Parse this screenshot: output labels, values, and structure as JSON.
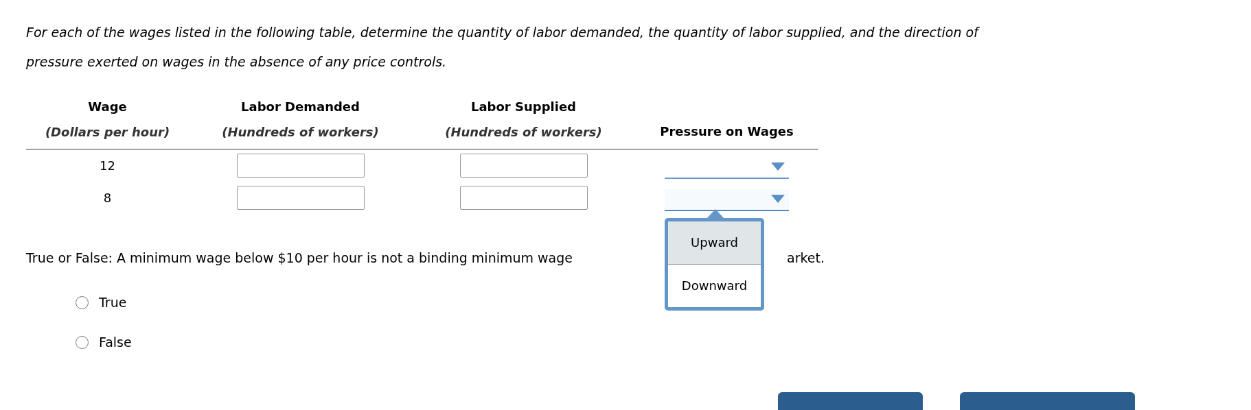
{
  "instructions": "For each of the wages listed in the following table, determine the quantity of labor demanded, the quantity of labor supplied, and the direction of pressure exerted on wages in the absence of any price controls.",
  "table": {
    "columns": [
      {
        "title": "Wage",
        "subtitle": "(Dollars per hour)"
      },
      {
        "title": "Labor Demanded",
        "subtitle": "(Hundreds of workers)"
      },
      {
        "title": "Labor Supplied",
        "subtitle": "(Hundreds of workers)"
      },
      {
        "title": "Pressure on Wages"
      }
    ],
    "rows": [
      {
        "wage": "12",
        "demanded": "",
        "supplied": "",
        "pressure": {
          "expanded": false
        }
      },
      {
        "wage": "8",
        "demanded": "",
        "supplied": "",
        "pressure": {
          "expanded": true,
          "options": [
            {
              "label": "Upward",
              "selected": true
            },
            {
              "label": "Downward",
              "selected": false
            }
          ]
        }
      }
    ]
  },
  "question": {
    "text_before": "True or False: A minimum wage below $10 per hour is not a binding minimum wage",
    "text_after": "arket.",
    "options": [
      {
        "label": "True",
        "checked": false
      },
      {
        "label": "False",
        "checked": false
      }
    ]
  },
  "footer_buttons": [
    {
      "kind": "primary"
    },
    {
      "kind": "primary"
    }
  ]
}
